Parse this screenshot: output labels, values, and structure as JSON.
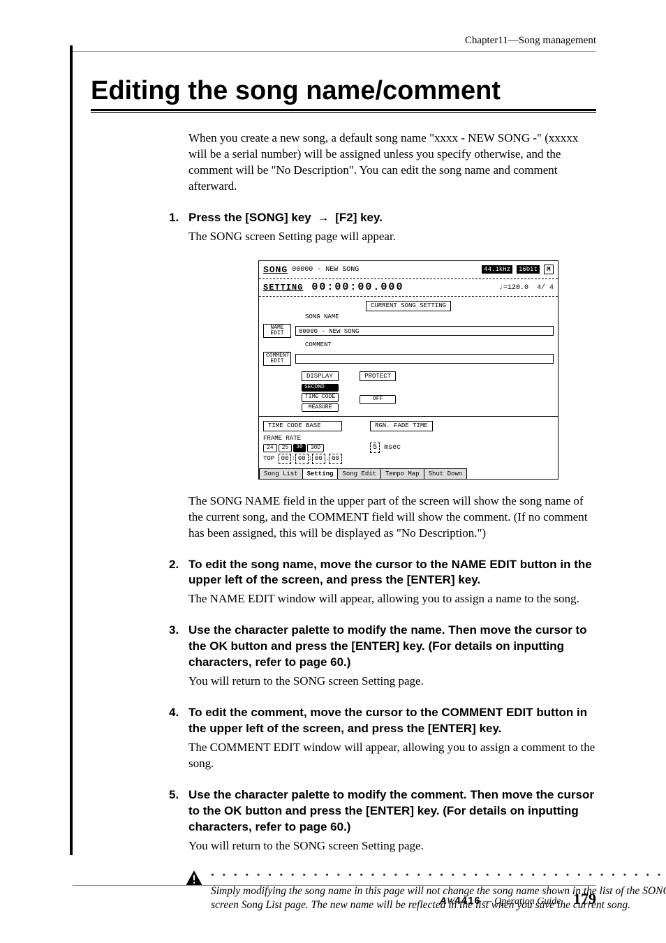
{
  "header": {
    "chapter": "Chapter11—Song management"
  },
  "title": "Editing the song name/comment",
  "intro": "When you create a new song, a default song name \"xxxx - NEW SONG -\" (xxxxx will be a serial number) will be assigned unless you specify otherwise, and the comment will be \"No Description\". You can edit the song name and comment afterward.",
  "steps": [
    {
      "num": "1.",
      "head_pre": "Press the [SONG] key ",
      "head_post": " [F2] key.",
      "body": "The SONG screen Setting page will appear."
    },
    {
      "num": "2.",
      "head": "To edit the song name, move the cursor to the NAME EDIT button in the upper left of the screen, and press the [ENTER] key.",
      "body": "The NAME EDIT window will appear, allowing you to assign a name to the song."
    },
    {
      "num": "3.",
      "head": "Use the character palette to modify the name. Then move the cursor to the OK button and press the [ENTER] key. (For details on inputting characters, refer to page 60.)",
      "body": "You will return to the SONG screen Setting page."
    },
    {
      "num": "4.",
      "head": "To edit the comment, move the cursor to the COMMENT EDIT button in the upper left of the screen, and press the [ENTER] key.",
      "body": "The COMMENT EDIT window will appear, allowing you to assign a comment to the song."
    },
    {
      "num": "5.",
      "head": "Use the character palette to modify the comment. Then move the cursor to the OK button and press the [ENTER] key. (For details on inputting characters, refer to page 60.)",
      "body": "You will return to the SONG screen Setting page."
    }
  ],
  "after_shot": "The SONG NAME field in the upper part of the screen will show the song name of the current song, and the COMMENT field will show the comment. (If no comment has been assigned, this will be displayed as \"No Description.\")",
  "note": "Simply modifying the song name in this page will not change the song name shown in the list of the SONG screen Song List page. The new name will be reflected in the list when you save the current song.",
  "lcd": {
    "title": "SONG",
    "song_id": "00000 - NEW SONG",
    "badge_rate": "44.1kHz",
    "badge_bit": "16bit",
    "setting_label": "SETTING",
    "timecode": "00:00:00.000",
    "tempo": "=120.0",
    "sig": "4/ 4",
    "group_title": "CURRENT SONG SETTING",
    "song_name_label": "SONG NAME",
    "name_edit_btn": "NAME\nEDIT",
    "song_name_value": "00000 - NEW SONG",
    "comment_label": "COMMENT",
    "comment_edit_btn": "COMMENT\nEDIT",
    "display_label": "DISPLAY",
    "display_opts": {
      "second": "SECOND",
      "timecode": "TIME CODE",
      "measure": "MEASURE"
    },
    "protect_label": "PROTECT",
    "protect_value": "OFF",
    "tcb_label": "TIME CODE BASE",
    "frame_rate_label": "FRAME RATE",
    "frame_rates": [
      "24",
      "25",
      "30",
      "30D"
    ],
    "top_label": "TOP",
    "top_value": "00 : 00 : 00 . 00",
    "fade_label": "RGN. FADE TIME",
    "fade_value": "5",
    "fade_unit": "msec",
    "tabs": [
      "Song List",
      "Setting",
      "Song Edit",
      "Tempo Map",
      "Shut Down"
    ]
  },
  "footer": {
    "model": "4416",
    "guide": " — Operation Guide",
    "page": "179"
  }
}
